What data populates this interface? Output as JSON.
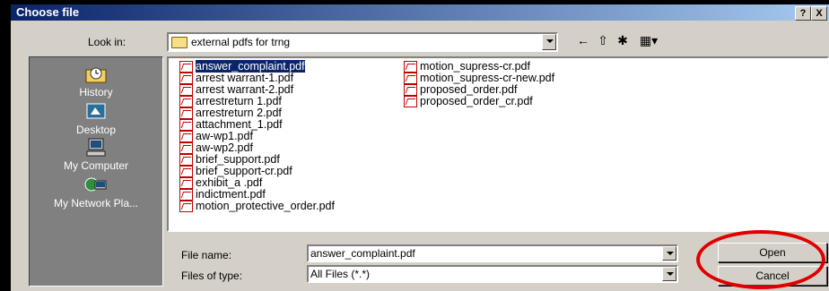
{
  "window": {
    "title": "Choose file",
    "help_btn": "?",
    "close_btn": "X"
  },
  "lookin": {
    "label": "Look in:",
    "value": "external pdfs for trng"
  },
  "toolbar": {
    "back_icon": "←",
    "up_icon": "⇧",
    "newfolder_icon": "✱",
    "views_icon": "▦▾"
  },
  "places": [
    {
      "label": "History",
      "icon": "history-icon"
    },
    {
      "label": "Desktop",
      "icon": "desktop-icon"
    },
    {
      "label": "My Computer",
      "icon": "my-computer-icon"
    },
    {
      "label": "My Network Pla...",
      "icon": "network-icon"
    }
  ],
  "files": {
    "col1": [
      "answer_complaint.pdf",
      "arrest warrant-1.pdf",
      "arrest warrant-2.pdf",
      "arrestreturn 1.pdf",
      "arrestreturn 2.pdf",
      "attachment_1.pdf",
      "aw-wp1.pdf",
      "aw-wp2.pdf",
      "brief_support.pdf",
      "brief_support-cr.pdf",
      "exhibit_a .pdf",
      "indictment.pdf",
      "motion_protective_order.pdf"
    ],
    "col2": [
      "motion_supress-cr.pdf",
      "motion_supress-cr-new.pdf",
      "proposed_order.pdf",
      "proposed_order_cr.pdf"
    ],
    "selected": "answer_complaint.pdf"
  },
  "filename": {
    "label": "File name:",
    "value": "answer_complaint.pdf"
  },
  "filetype": {
    "label": "Files of type:",
    "value": "All Files (*.*)"
  },
  "buttons": {
    "open": "Open",
    "cancel": "Cancel"
  },
  "colors": {
    "highlight_ring": "#e00000",
    "title_bar": "#0a246a"
  }
}
